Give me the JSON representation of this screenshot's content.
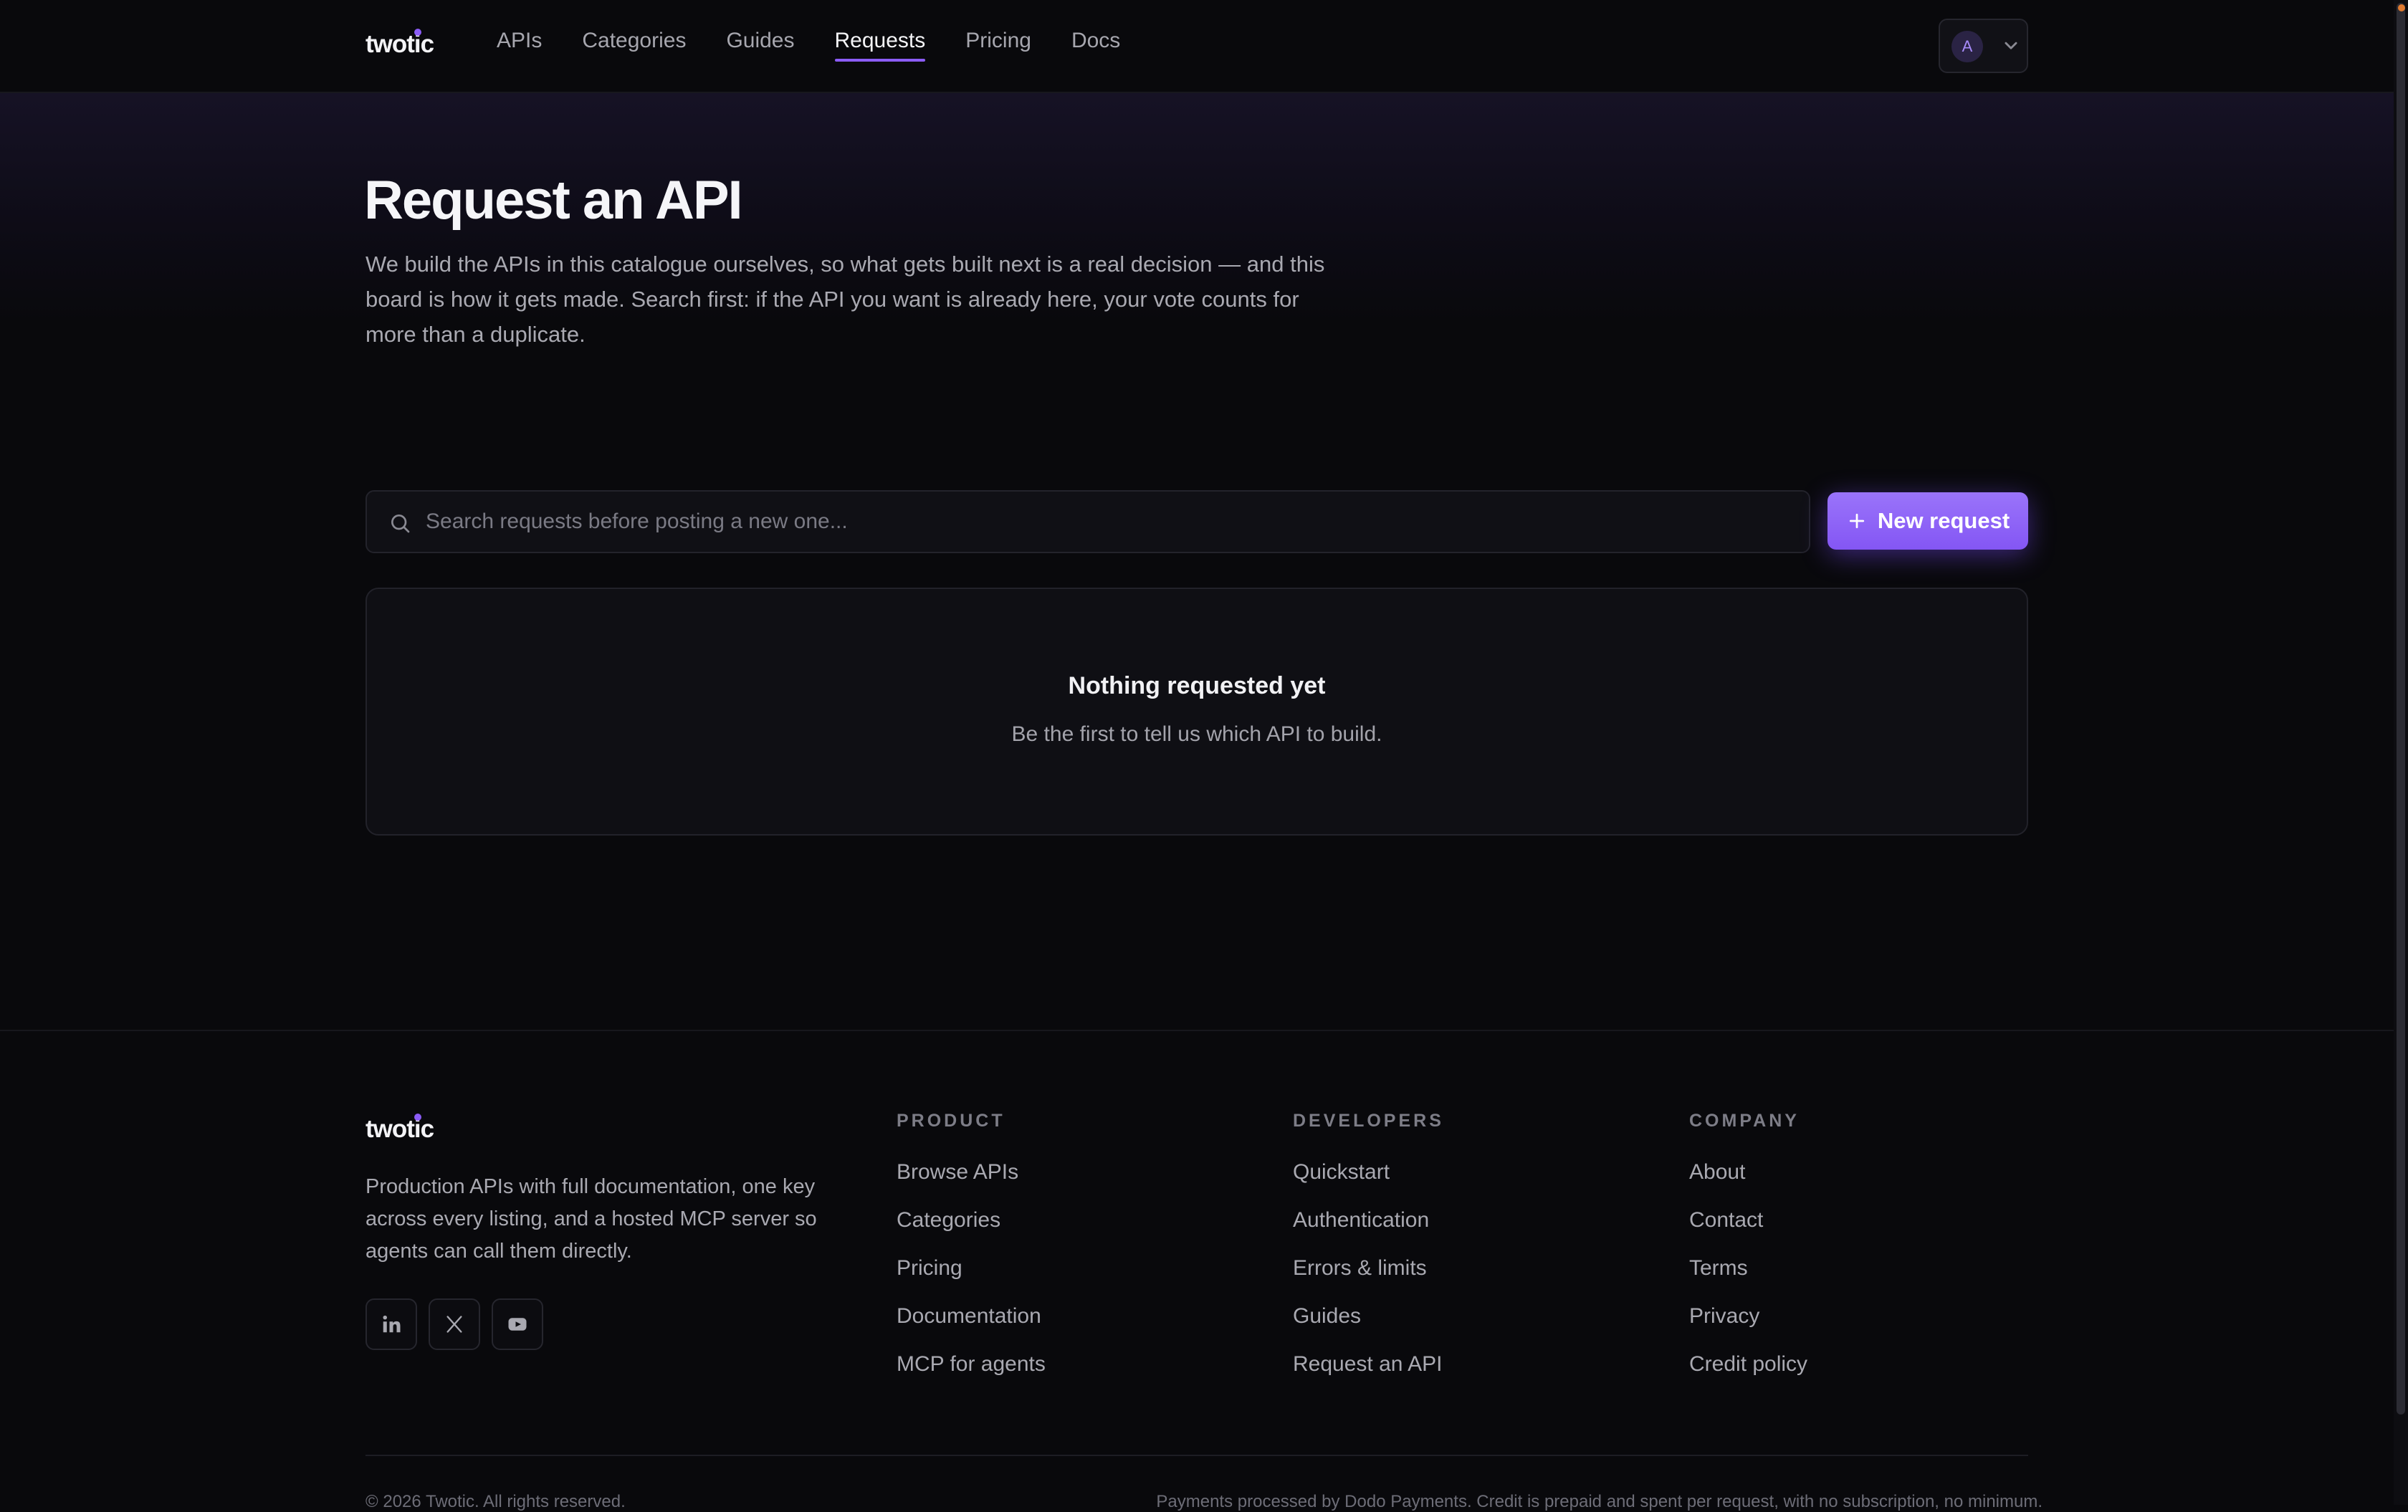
{
  "brand": {
    "name": "twotic",
    "accent_color": "#8b5cf6"
  },
  "nav": {
    "items": [
      {
        "label": "APIs",
        "active": false
      },
      {
        "label": "Categories",
        "active": false
      },
      {
        "label": "Guides",
        "active": false
      },
      {
        "label": "Requests",
        "active": true
      },
      {
        "label": "Pricing",
        "active": false
      },
      {
        "label": "Docs",
        "active": false
      }
    ]
  },
  "account": {
    "avatar_initial": "A",
    "menu_icon": "chevron-down-icon"
  },
  "page": {
    "title": "Request an API",
    "intro": "We build the APIs in this catalogue ourselves, so what gets built next is a real decision — and this board is how it gets made. Search first: if the API you want is already here, your vote counts for more than a duplicate."
  },
  "search": {
    "placeholder": "Search requests before posting a new one...",
    "value": "",
    "icon": "search-icon"
  },
  "new_request": {
    "label": "New request",
    "icon": "plus-icon"
  },
  "empty_state": {
    "title": "Nothing requested yet",
    "subtitle": "Be the first to tell us which API to build."
  },
  "footer": {
    "brand": "twotic",
    "tagline": "Production APIs with full documentation, one key across every listing, and a hosted MCP server so agents can call them directly.",
    "socials": [
      "linkedin-icon",
      "x-icon",
      "youtube-icon"
    ],
    "columns": [
      {
        "heading": "PRODUCT",
        "links": [
          "Browse APIs",
          "Categories",
          "Pricing",
          "Documentation",
          "MCP for agents"
        ]
      },
      {
        "heading": "DEVELOPERS",
        "links": [
          "Quickstart",
          "Authentication",
          "Errors & limits",
          "Guides",
          "Request an API"
        ]
      },
      {
        "heading": "COMPANY",
        "links": [
          "About",
          "Contact",
          "Terms",
          "Privacy",
          "Credit policy"
        ]
      }
    ],
    "copyright": "© 2026 Twotic. All rights reserved.",
    "payments_note": "Payments processed by Dodo Payments. Credit is prepaid and spent per request, with no subscription, no minimum."
  }
}
